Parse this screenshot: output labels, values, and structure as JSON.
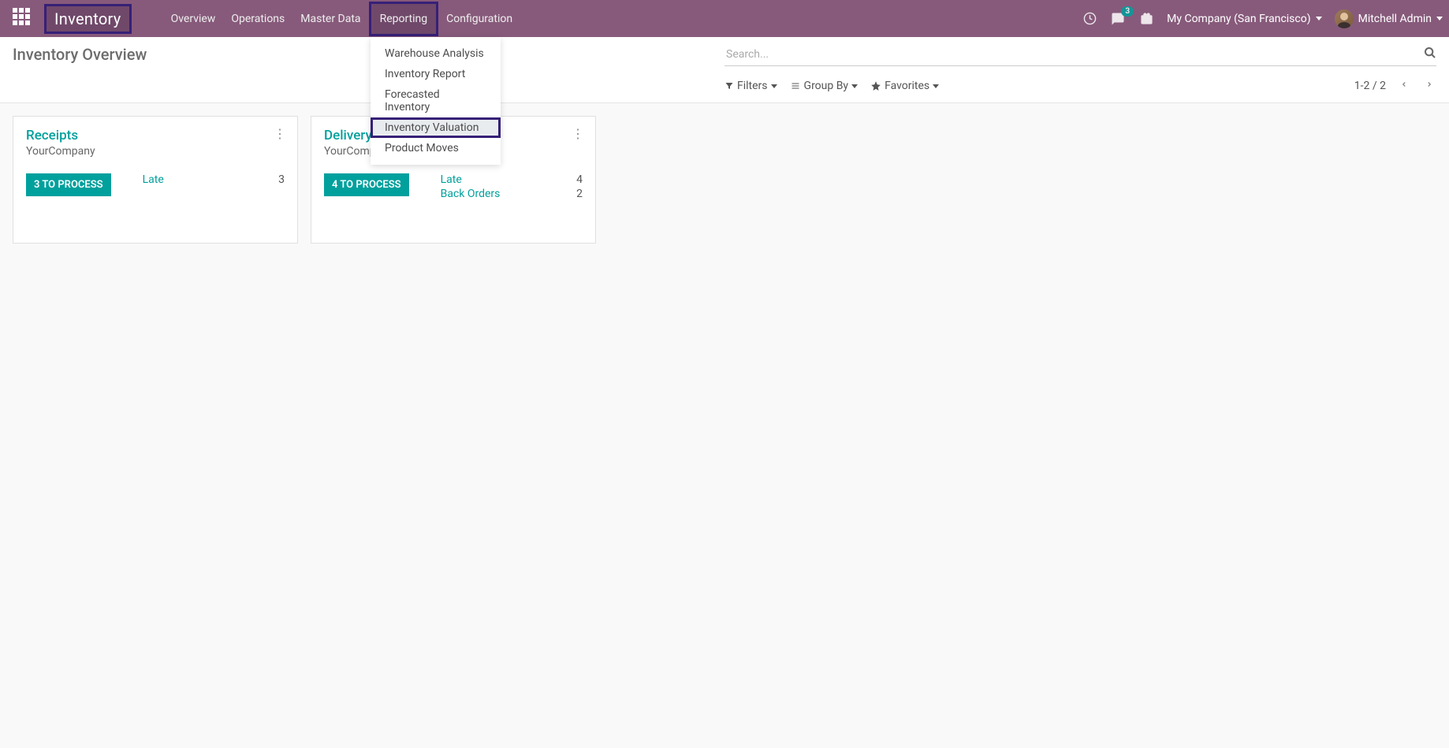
{
  "navbar": {
    "brand": "Inventory",
    "items": [
      {
        "label": "Overview"
      },
      {
        "label": "Operations"
      },
      {
        "label": "Master Data"
      },
      {
        "label": "Reporting"
      },
      {
        "label": "Configuration"
      }
    ],
    "chat_badge": "3",
    "company": "My Company (San Francisco)",
    "user": "Mitchell Admin"
  },
  "dropdown": {
    "items": [
      {
        "label": "Warehouse Analysis"
      },
      {
        "label": "Inventory Report"
      },
      {
        "label": "Forecasted Inventory"
      },
      {
        "label": "Inventory Valuation"
      },
      {
        "label": "Product Moves"
      }
    ]
  },
  "page": {
    "title": "Inventory Overview"
  },
  "search": {
    "placeholder": "Search..."
  },
  "filters": {
    "filters_label": "Filters",
    "groupby_label": "Group By",
    "favorites_label": "Favorites"
  },
  "pager": {
    "text": "1-2 / 2"
  },
  "cards": [
    {
      "title": "Receipts",
      "subtitle": "YourCompany",
      "button": "3 TO PROCESS",
      "stats": [
        {
          "label": "Late",
          "count": "3"
        }
      ]
    },
    {
      "title": "Delivery Orders",
      "subtitle": "YourCompany",
      "button": "4 TO PROCESS",
      "stats": [
        {
          "label": "Late",
          "count": "4"
        },
        {
          "label": "Back Orders",
          "count": "2"
        }
      ]
    }
  ]
}
